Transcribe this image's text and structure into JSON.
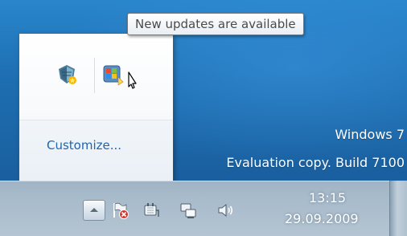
{
  "tooltip": {
    "text": "New updates are available"
  },
  "tray_popup": {
    "icons": [
      {
        "name": "security-center-icon"
      },
      {
        "name": "windows-update-icon"
      }
    ],
    "customize_label": "Customize..."
  },
  "watermark": {
    "line1": "Windows 7",
    "line2": "Evaluation copy. Build 7100"
  },
  "taskbar": {
    "icons": [
      "show-hidden-icons-icon",
      "action-center-flag-icon",
      "power-icon",
      "network-icon",
      "volume-icon"
    ],
    "clock": {
      "time": "13:15",
      "date": "29.09.2009"
    }
  },
  "colors": {
    "desktop": "#1f6fb0",
    "taskbar": "#a8bbcb",
    "link": "#1e64b4"
  }
}
